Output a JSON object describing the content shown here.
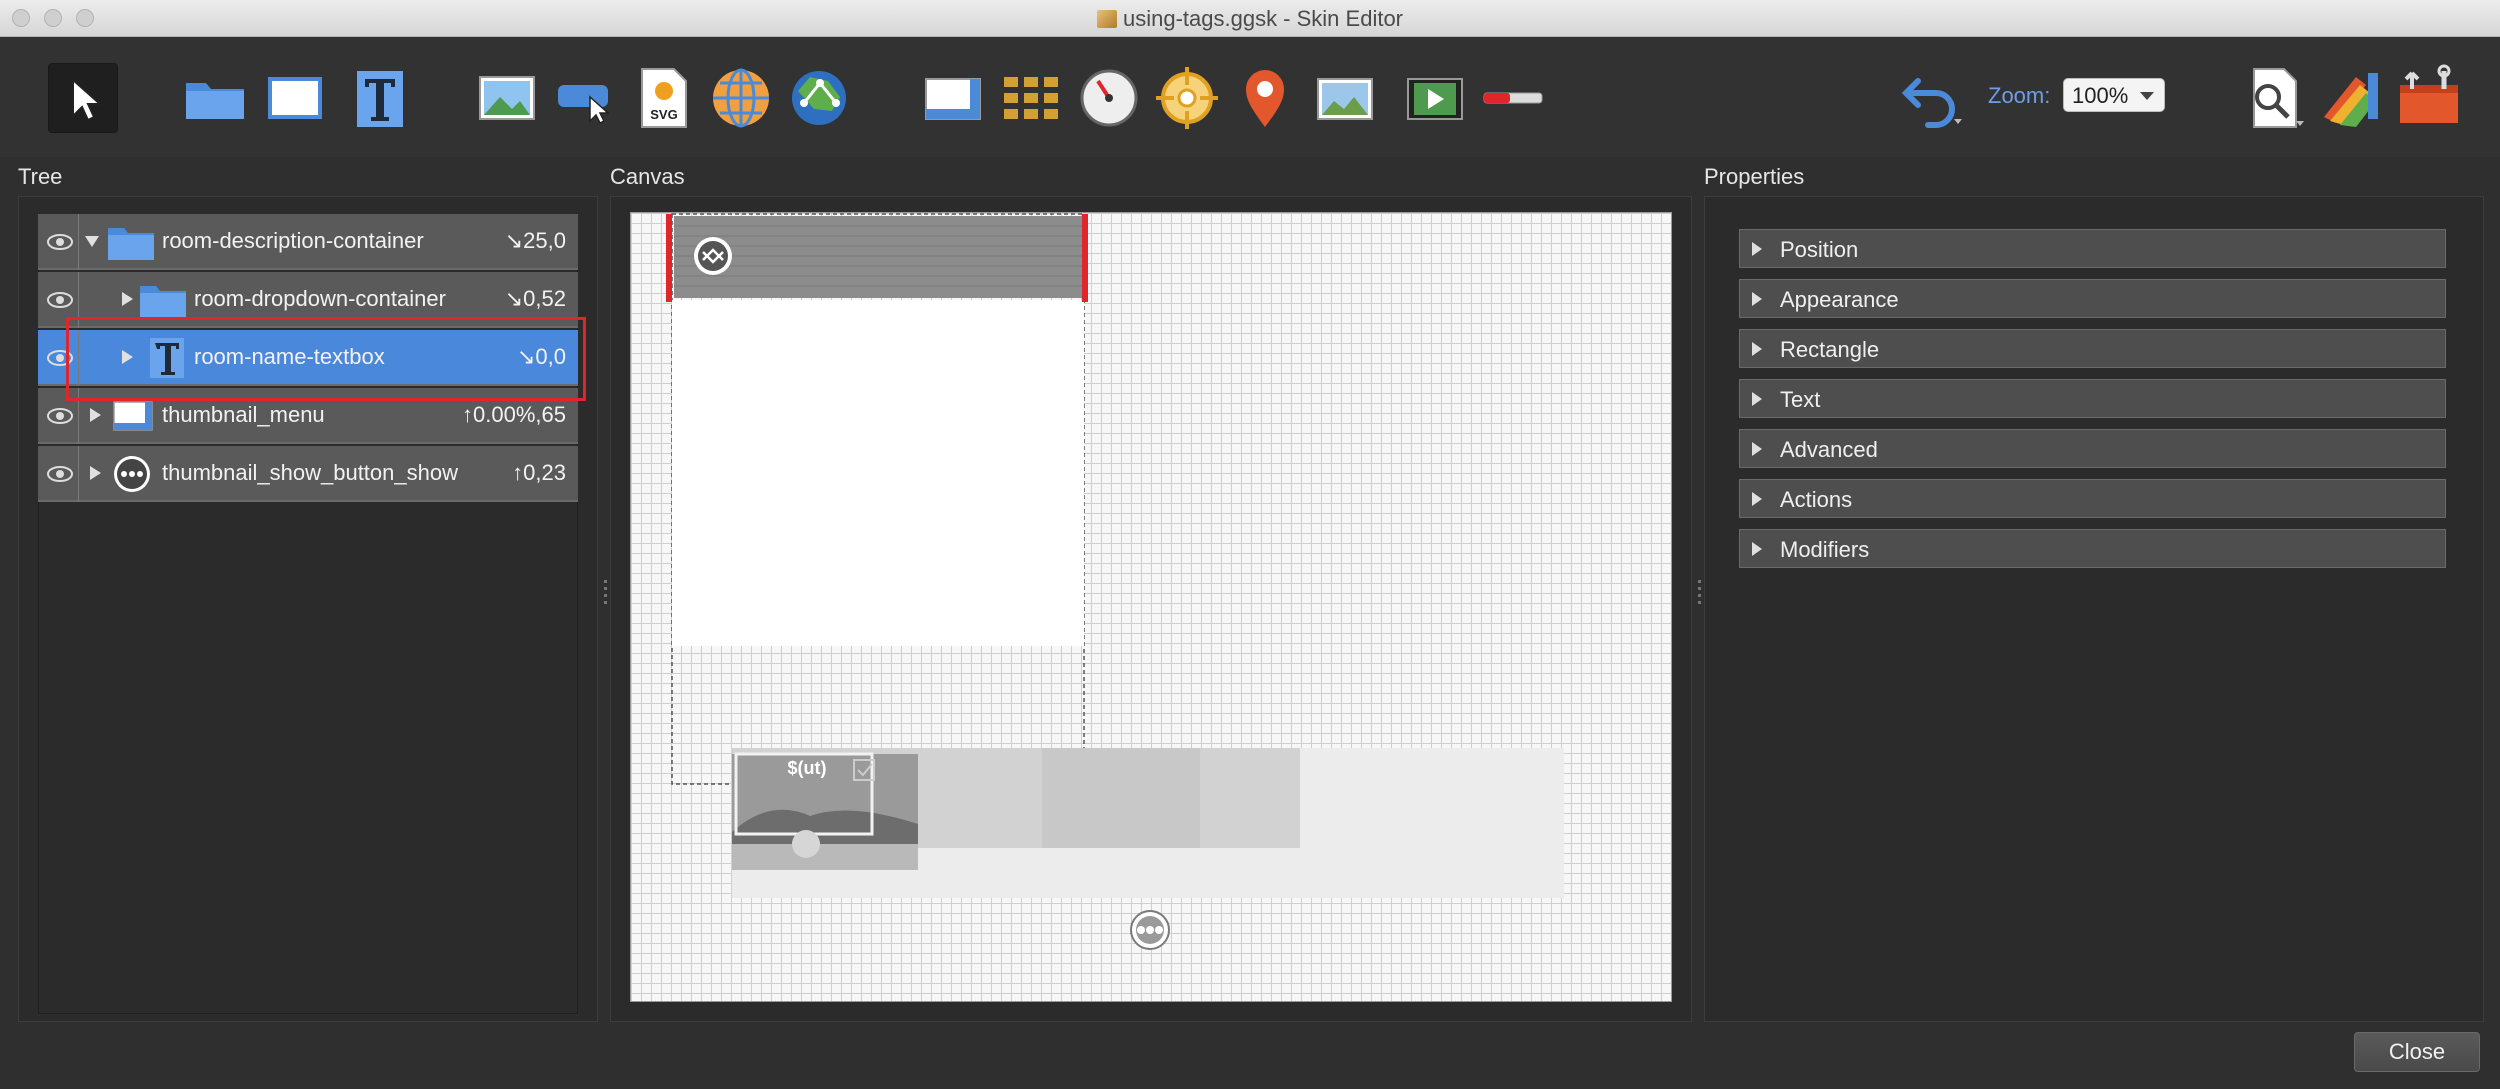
{
  "window": {
    "title": "using-tags.ggsk - Skin Editor"
  },
  "toolbar": {
    "tools": [
      "select-tool",
      "container-tool",
      "rectangle-tool",
      "text-tool",
      "image-tool",
      "button-tool",
      "svg-tool",
      "hotspot-tool",
      "map-tool",
      "scrollarea-tool",
      "cloner-tool",
      "dial-tool",
      "compass-tool",
      "map-pin-tool",
      "panorama-tool",
      "video-tool",
      "progress-bar-tool",
      "undo-tool",
      "preview-tool",
      "theme-tool",
      "settings-tool"
    ],
    "zoom_label": "Zoom:",
    "zoom_value": "100%"
  },
  "panels": {
    "tree": "Tree",
    "canvas": "Canvas",
    "properties": "Properties"
  },
  "tree": {
    "rows": [
      {
        "name": "room-description-container",
        "value": "↘25,0"
      },
      {
        "name": "room-dropdown-container",
        "value": "↘0,52"
      },
      {
        "name": "room-name-textbox",
        "value": "↘0,0"
      },
      {
        "name": "thumbnail_menu",
        "value": "↑0.00%,65"
      },
      {
        "name": "thumbnail_show_button_show",
        "value": "↑0,23"
      }
    ]
  },
  "canvas": {
    "thumbnail_text": "$(ut)"
  },
  "properties": {
    "sections": [
      "Position",
      "Appearance",
      "Rectangle",
      "Text",
      "Advanced",
      "Actions",
      "Modifiers"
    ]
  },
  "footer": {
    "close_label": "Close"
  },
  "colors": {
    "accent": "#4a88dc",
    "highlight": "#e0262b",
    "zoom_label": "#6e9fe6"
  }
}
